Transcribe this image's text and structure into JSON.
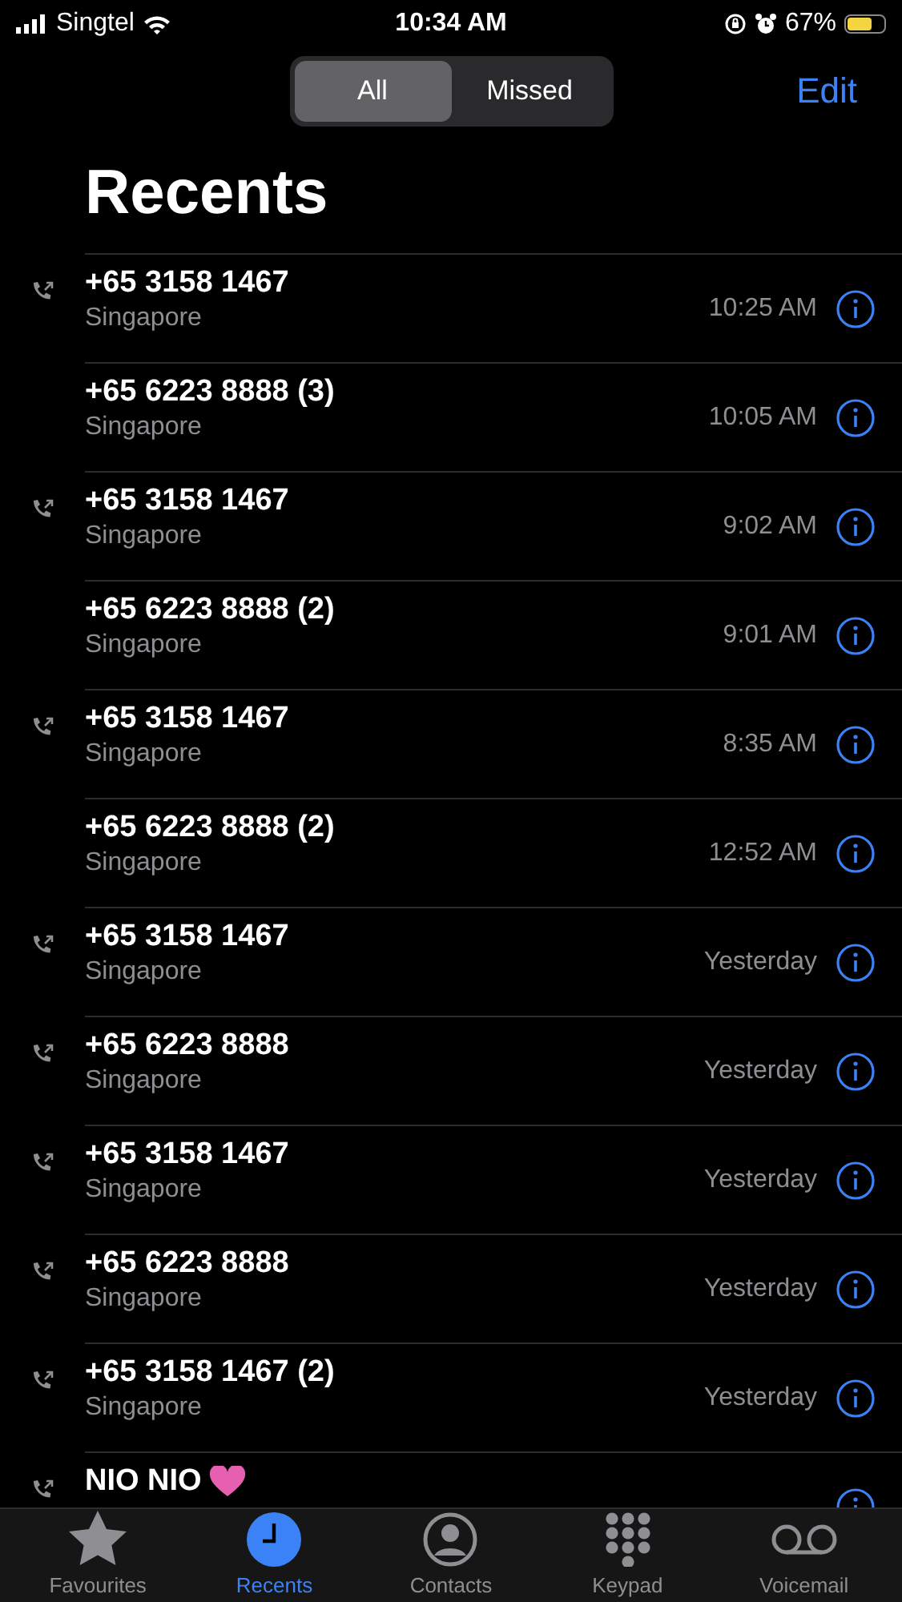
{
  "status_bar": {
    "carrier": "Singtel",
    "time": "10:34 AM",
    "battery": "67%"
  },
  "segments": [
    {
      "label": "All",
      "selected": true
    },
    {
      "label": "Missed",
      "selected": false
    }
  ],
  "edit": "Edit",
  "title": "Recents",
  "calls": [
    {
      "name": "+65 3158 1467",
      "place": "Singapore",
      "time": "10:25 AM",
      "outgoing": true
    },
    {
      "name": "+65 6223 8888 (3)",
      "place": "Singapore",
      "time": "10:05 AM",
      "outgoing": false
    },
    {
      "name": "+65 3158 1467",
      "place": "Singapore",
      "time": "9:02 AM",
      "outgoing": true
    },
    {
      "name": "+65 6223 8888 (2)",
      "place": "Singapore",
      "time": "9:01 AM",
      "outgoing": false
    },
    {
      "name": "+65 3158 1467",
      "place": "Singapore",
      "time": "8:35 AM",
      "outgoing": true
    },
    {
      "name": "+65 6223 8888 (2)",
      "place": "Singapore",
      "time": "12:52 AM",
      "outgoing": false
    },
    {
      "name": "+65 3158 1467",
      "place": "Singapore",
      "time": "Yesterday",
      "outgoing": true
    },
    {
      "name": "+65 6223 8888",
      "place": "Singapore",
      "time": "Yesterday",
      "outgoing": true
    },
    {
      "name": "+65 3158 1467",
      "place": "Singapore",
      "time": "Yesterday",
      "outgoing": true
    },
    {
      "name": "+65 6223 8888",
      "place": "Singapore",
      "time": "Yesterday",
      "outgoing": true
    },
    {
      "name": "+65 3158 1467 (2)",
      "place": "Singapore",
      "time": "Yesterday",
      "outgoing": true
    },
    {
      "name": "NIO NIO",
      "outgoing": true,
      "heart": true
    }
  ],
  "tabs": [
    {
      "label": "Favourites",
      "kind": "star",
      "selected": false
    },
    {
      "label": "Recents",
      "kind": "clock",
      "selected": true
    },
    {
      "label": "Contacts",
      "kind": "person",
      "selected": false
    },
    {
      "label": "Keypad",
      "kind": "keypad",
      "selected": false
    },
    {
      "label": "Voicemail",
      "kind": "voicemail",
      "selected": false
    }
  ]
}
